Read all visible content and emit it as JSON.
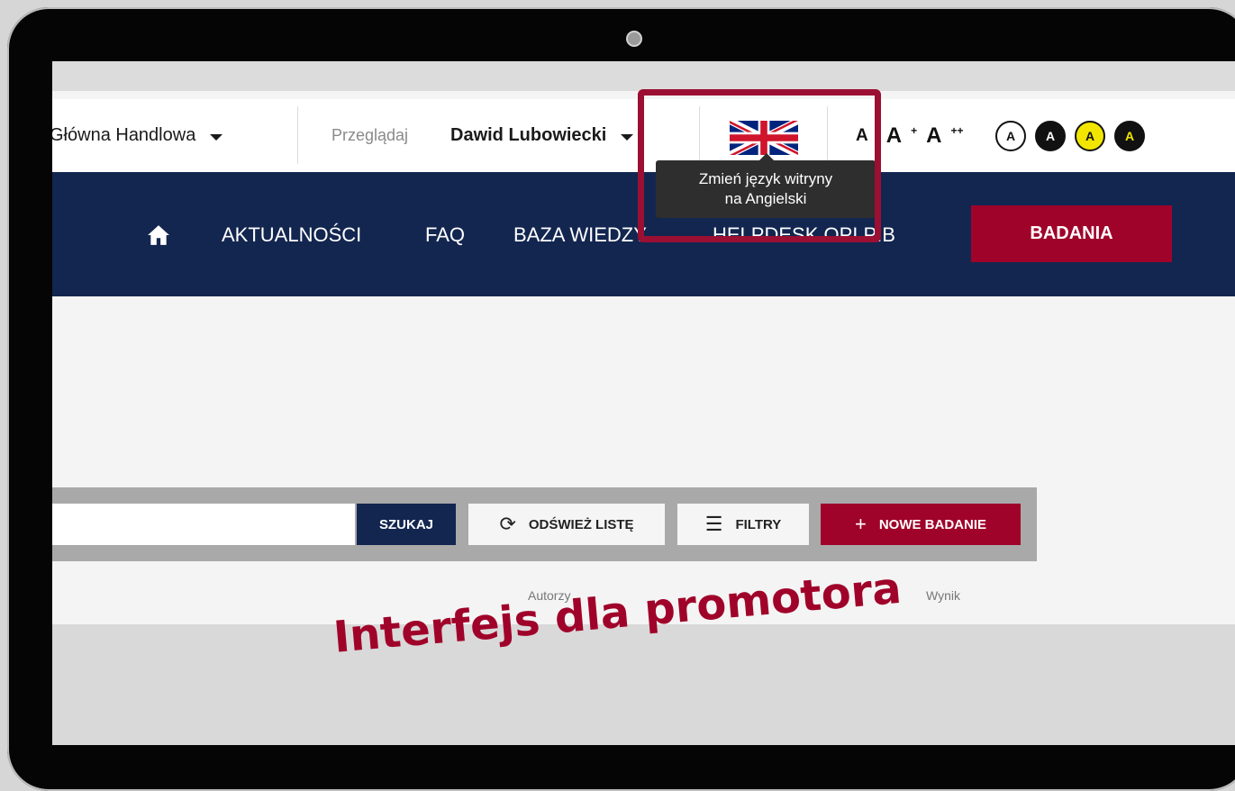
{
  "topbar": {
    "site_label": "Główna Handlowa",
    "browse_label": "Przeglądaj",
    "user_name": "Dawid Lubowiecki",
    "language_flag": "uk-flag-icon",
    "font_sizes": [
      "A",
      "A",
      "A"
    ],
    "font_size_sups": [
      "",
      "+",
      "++"
    ],
    "contrast_options": [
      "A",
      "A",
      "A",
      "A"
    ]
  },
  "tooltip": {
    "line1": "Zmień język witryny",
    "line2": "na Angielski"
  },
  "nav": {
    "home_icon": "home-icon",
    "links": [
      "AKTUALNOŚCI",
      "FAQ",
      "BAZA WIEDZY",
      "HELPDESK OPI PIB"
    ],
    "cta": "BADANIA"
  },
  "toolbar": {
    "search_value": "",
    "search_label": "SZUKAJ",
    "refresh_label": "ODŚWIEŻ LISTĘ",
    "filters_label": "FILTRY",
    "new_label": "NOWE BADANIE"
  },
  "table": {
    "columns": [
      "Autorzy",
      "Wynik"
    ]
  },
  "caption": "Interfejs dla promotora",
  "colors": {
    "navy": "#132650",
    "accent": "#a0032a"
  }
}
